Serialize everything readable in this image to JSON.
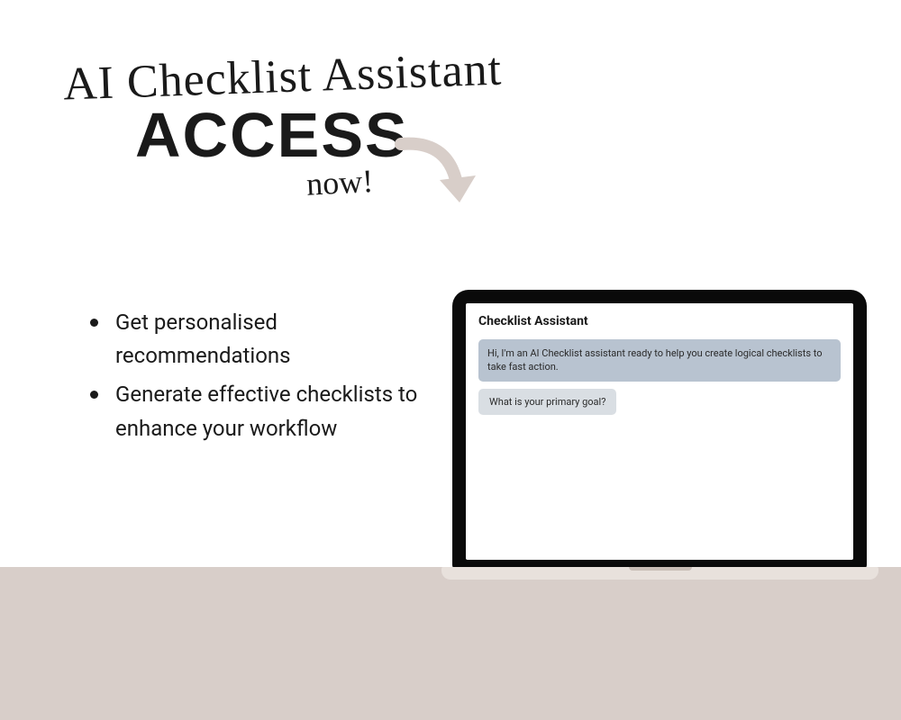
{
  "hero": {
    "script_title": "AI Checklist Assistant",
    "access_title": "ACCESS",
    "now_text": "now!"
  },
  "bullets": [
    "Get personalised recommendations",
    "Generate effective checklists to enhance your workflow"
  ],
  "laptop": {
    "chat_title": "Checklist Assistant",
    "messages": [
      "Hi, I'm an AI Checklist assistant ready to help you create logical checklists to take fast action.",
      "What is your primary goal?"
    ]
  },
  "colors": {
    "band": "#d8cec9",
    "bubble_primary": "#b8c3d0",
    "bubble_secondary": "#d9dee3",
    "arrow": "#d8cec9"
  }
}
